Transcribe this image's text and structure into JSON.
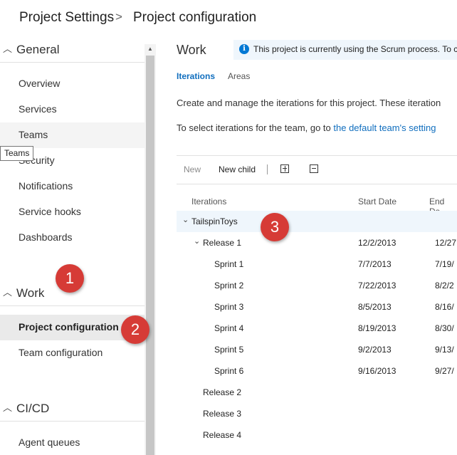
{
  "breadcrumb": {
    "root": "Project Settings",
    "separator": ">",
    "current": "Project configuration"
  },
  "sidebar": {
    "groups": [
      {
        "label": "General",
        "items": [
          "Overview",
          "Services",
          "Teams",
          "Security",
          "Notifications",
          "Service hooks",
          "Dashboards"
        ]
      },
      {
        "label": "Work",
        "items": [
          "Project configuration",
          "Team configuration"
        ]
      },
      {
        "label": "CI/CD",
        "items": [
          "Agent queues"
        ]
      }
    ],
    "tooltip": "Teams"
  },
  "main": {
    "title": "Work",
    "info": "This project is currently using the Scrum process. To cu",
    "tabs": [
      "Iterations",
      "Areas"
    ],
    "description": "Create and manage the iterations for this project. These iteration",
    "team_prompt": "To select iterations for the team, go to ",
    "team_link": "the default team's setting",
    "toolbar": {
      "new": "New",
      "new_child": "New child"
    },
    "columns": [
      "Iterations",
      "Start Date",
      "End Da"
    ],
    "rows": [
      {
        "name": "TailspinToys",
        "start": "",
        "end": ""
      },
      {
        "name": "Release 1",
        "start": "12/2/2013",
        "end": "12/27"
      },
      {
        "name": "Sprint 1",
        "start": "7/7/2013",
        "end": "7/19/"
      },
      {
        "name": "Sprint 2",
        "start": "7/22/2013",
        "end": "8/2/2"
      },
      {
        "name": "Sprint 3",
        "start": "8/5/2013",
        "end": "8/16/"
      },
      {
        "name": "Sprint 4",
        "start": "8/19/2013",
        "end": "8/30/"
      },
      {
        "name": "Sprint 5",
        "start": "9/2/2013",
        "end": "9/13/"
      },
      {
        "name": "Sprint 6",
        "start": "9/16/2013",
        "end": "9/27/"
      },
      {
        "name": "Release 2",
        "start": "",
        "end": ""
      },
      {
        "name": "Release 3",
        "start": "",
        "end": ""
      },
      {
        "name": "Release 4",
        "start": "",
        "end": ""
      }
    ]
  },
  "callouts": [
    "1",
    "2",
    "3"
  ],
  "colors": {
    "accent": "#0078d4",
    "link": "#106ebe",
    "callout": "#d63b36",
    "selected_bg": "#eaeaea",
    "info_bg": "#eff6fc"
  }
}
